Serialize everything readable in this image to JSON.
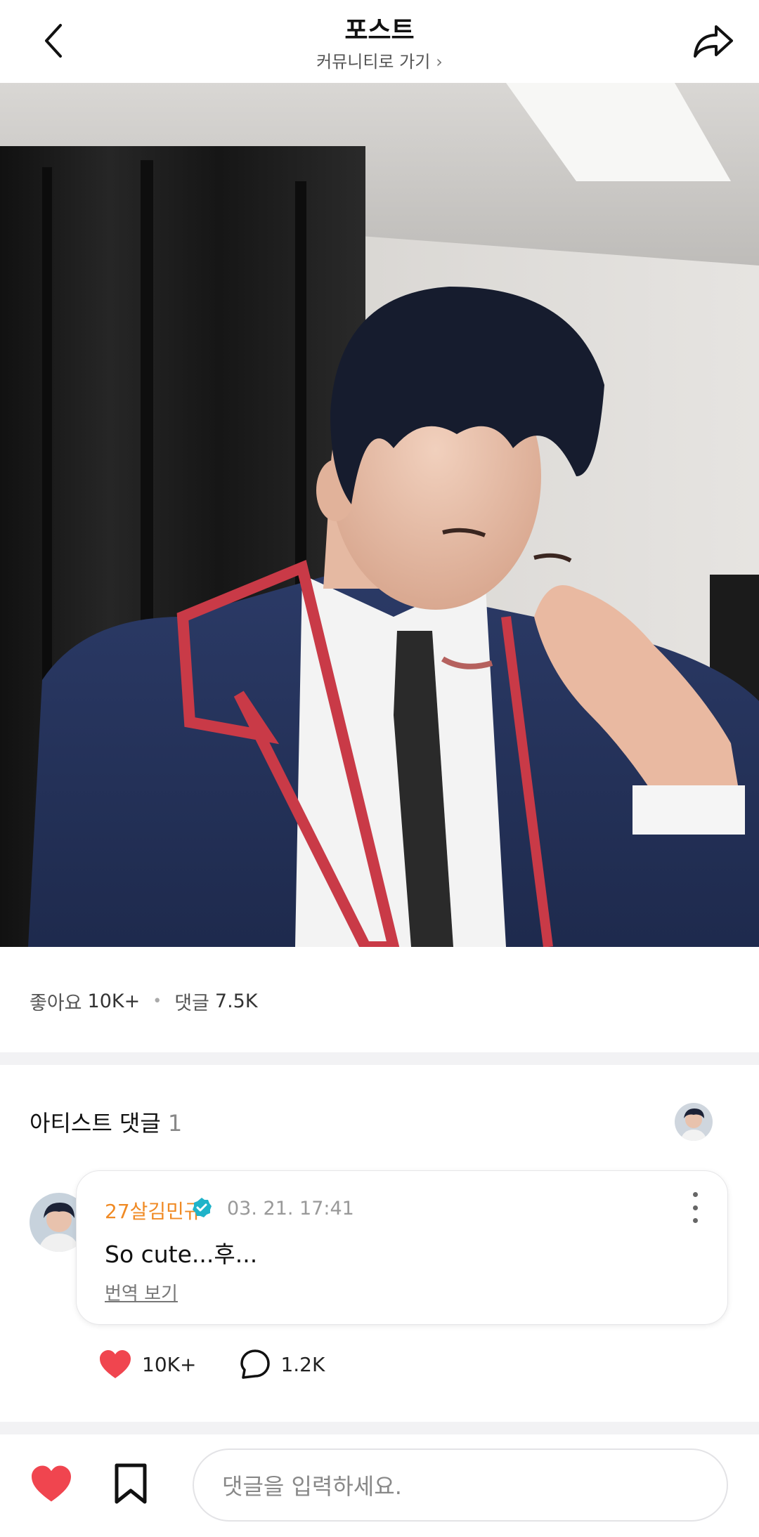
{
  "header": {
    "title": "포스트",
    "subtitle": "커뮤니티로 가기",
    "back_icon": "chevron-left-icon",
    "share_icon": "share-forward-icon"
  },
  "post": {
    "image_alt": "photo"
  },
  "stats": {
    "likes_label": "좋아요",
    "likes_value": "10K+",
    "comments_label": "댓글",
    "comments_value": "7.5K"
  },
  "artist_comments": {
    "title": "아티스트 댓글",
    "count": "1",
    "comment": {
      "author": "27살김민규",
      "date": "03. 21. 17:41",
      "text": "So cute...후...",
      "translate_label": "번역 보기",
      "likes": "10K+",
      "replies": "1.2K"
    }
  },
  "bottom_bar": {
    "input_placeholder": "댓글을 입력하세요."
  },
  "colors": {
    "heart": "#f0454f",
    "author": "#f08a24",
    "verified": "#1fb3c9",
    "divider": "#f2f2f4"
  }
}
